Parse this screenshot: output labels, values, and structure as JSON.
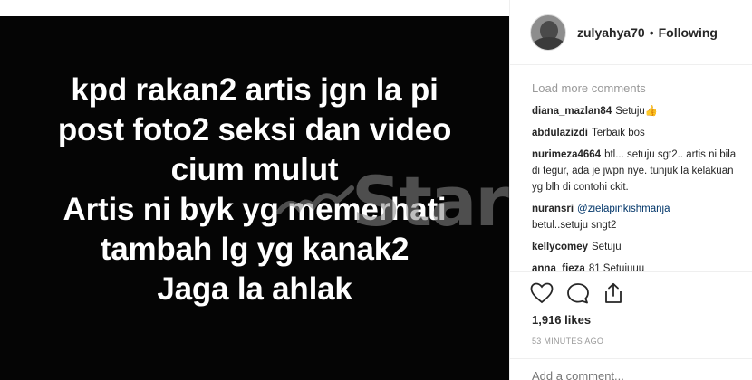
{
  "post_image": {
    "lines": [
      "kpd rakan2 artis jgn la pi",
      "post foto2 seksi dan video",
      "cium mulut",
      "Artis ni byk yg memerhati",
      "tambah lg yg kanak2",
      "Jaga la ahlak"
    ],
    "watermark": "mStar"
  },
  "header": {
    "avatar_icon": "user-avatar",
    "username": "zulyahya70",
    "separator": "•",
    "follow_state": "Following"
  },
  "comments": {
    "load_more": "Load more comments",
    "items": [
      {
        "user": "diana_mazlan84",
        "text": "Setuju👍"
      },
      {
        "user": "abdulazizdi",
        "text": "Terbaik bos"
      },
      {
        "user": "nurimeza4664",
        "text": "btl... setuju sgt2.. artis ni bila di tegur, ada je jwpn nye. tunjuk la kelakuan yg blh di contohi ckit."
      },
      {
        "user": "nuransri",
        "mention": "@zielapinkishmanja",
        "text": "betul..setuju sngt2"
      },
      {
        "user": "kellycomey",
        "text": "Setuju"
      },
      {
        "user": "anna_fieza",
        "text": "81 Setuiuuu"
      }
    ]
  },
  "actions": {
    "like_icon": "heart-icon",
    "comment_icon": "comment-bubble-icon",
    "share_icon": "share-upload-icon",
    "likes": "1,916 likes",
    "timestamp": "53 MINUTES AGO",
    "add_comment_placeholder": "Add a comment..."
  }
}
